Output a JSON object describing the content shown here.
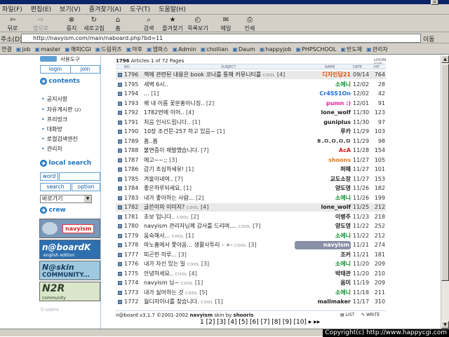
{
  "menu": [
    "파일(F)",
    "편집(E)",
    "보기(V)",
    "즐겨찾기(A)",
    "도구(T)",
    "도움말(H)"
  ],
  "toolbar": {
    "back": "뒤로",
    "forward": "앞으로",
    "stop": "중지",
    "refresh": "새로고침",
    "home": "홈",
    "search": "검색",
    "favorites": "즐겨찾기",
    "history": "목록보기",
    "mail": "메일",
    "print": "인쇄"
  },
  "address": {
    "label": "주소(D)",
    "url": "http://navyism.com/main/naboard.php?bd=11",
    "go": "이동"
  },
  "links": {
    "label": "연결",
    "items": [
      "job",
      "master",
      "해피CGI",
      "드림위즈",
      "야후",
      "엠파스",
      "Admin",
      "chollian",
      "Daum",
      "happyjob",
      "PHPSCHOOL",
      "반도체",
      "관리자"
    ]
  },
  "sidebar": {
    "top_text": "사용도구",
    "login": "login",
    "join": "join",
    "contents_title": "contents",
    "contents": [
      "공지사항",
      "자유게시판",
      "프리빙크",
      "대화방",
      "로컬검색엔진",
      "관리자"
    ],
    "contents_count": "(2)",
    "local_search_title": "local search",
    "word_label": "word",
    "search_btn": "search",
    "option_btn": "option",
    "select_value": "바로가기",
    "crew_title": "crew",
    "banners": [
      {
        "text": "navyism",
        "bg": "#7a98b8",
        "fg": "#ffffff"
      },
      {
        "text": "n@boardK",
        "sub": "english edition",
        "bg": "#2e6fb0",
        "fg": "#ffffff"
      },
      {
        "text": "N@skin",
        "sub": "COMMUNITY...",
        "bg": "#9ec9de",
        "fg": "#1a3a60"
      },
      {
        "text": "N2R",
        "sub": "community",
        "bg": "#d9e6c9",
        "fg": "#304030"
      }
    ],
    "users": "0 users"
  },
  "board": {
    "count": "1796",
    "count_text": "Articles 1 of 72 Pages",
    "login_link": "LOGIN",
    "join_link": "JOIN",
    "cols": {
      "no": "NO",
      "subject": "SUBJECT",
      "name": "NAME",
      "date": "DATE",
      "hit": "HIT"
    },
    "rows": [
      {
        "no": "1796",
        "subject": "책에 관련된 내용은 book 코너를 통해 커뮤니티를",
        "cnt": "[4]",
        "cool": "COOL",
        "name": "디자인답21",
        "name_color": "#e05010",
        "date": "09/14",
        "hit": "764",
        "hl": true
      },
      {
        "no": "1795",
        "subject": "새벽 6시..",
        "cnt": "",
        "cool": "",
        "name": "소에니",
        "name_color": "#0a8a2a",
        "date": "12/02",
        "hit": "28",
        "hl": false
      },
      {
        "no": "1794",
        "subject": "...",
        "cnt": "[1]",
        "cool": "",
        "name": "Cr4SS1On",
        "name_color": "#1d6dd8",
        "date": "12/02",
        "hit": "42",
        "hl": false
      },
      {
        "no": "1793",
        "subject": "왜 내 이름 꽃분홍아니징..",
        "cnt": "[2]",
        "cool": "",
        "name": "pumn :)",
        "name_color": "#e0209a",
        "date": "12/01",
        "hit": "91",
        "hl": false
      },
      {
        "no": "1792",
        "subject": "1782번에 이어..",
        "cnt": "[4]",
        "cool": "",
        "name": "lone_wolf",
        "name_color": "#222222",
        "date": "11/30",
        "hit": "123",
        "hl": false
      },
      {
        "no": "1791",
        "subject": "처음 인사드립니다..",
        "cnt": "[1]",
        "cool": "",
        "name": "guniplus",
        "name_color": "#222222",
        "date": "11/30",
        "hit": "97",
        "hl": false
      },
      {
        "no": "1790",
        "subject": "10장 조건문-257 하고 있음~",
        "cnt": "[1]",
        "cool": "",
        "name": "루카",
        "name_color": "#222222",
        "date": "11/29",
        "hit": "103",
        "hl": false
      },
      {
        "no": "1789",
        "subject": "흠..흠",
        "cnt": "",
        "cool": "",
        "name": "ㅎ.ㅁ.ㅁ.ㅁ.ㅁ",
        "name_color": "#222222",
        "date": "11/29",
        "hit": "98",
        "hl": false
      },
      {
        "no": "1788",
        "subject": "불면증이 재발했습니다.",
        "cnt": "[7]",
        "cool": "",
        "name": "AcA",
        "name_color": "#d02020",
        "date": "11/28",
        "hit": "154",
        "hl": false
      },
      {
        "no": "1787",
        "subject": "에고~~;;",
        "cnt": "[3]",
        "cool": "",
        "name": "shoons",
        "name_color": "#e07818",
        "date": "11/27",
        "hit": "105",
        "hl": false
      },
      {
        "no": "1786",
        "subject": "갑기 조심하세유!",
        "cnt": "[1]",
        "cool": "",
        "name": "퍼떼",
        "name_color": "#222222",
        "date": "11/27",
        "hit": "101",
        "hl": false
      },
      {
        "no": "1785",
        "subject": "겨울이네여..",
        "cnt": "[7]",
        "cool": "",
        "name": "교도소장",
        "name_color": "#222222",
        "date": "11/27",
        "hit": "153",
        "hl": false
      },
      {
        "no": "1784",
        "subject": "좋은하루되세요,",
        "cnt": "[1]",
        "cool": "",
        "name": "양도영",
        "name_color": "#222222",
        "date": "11/26",
        "hit": "182",
        "hl": false
      },
      {
        "no": "1783",
        "subject": "내가 좋아하는 사람...",
        "cnt": "[2]",
        "cool": "",
        "name": "소에니",
        "name_color": "#0a8a2a",
        "date": "11/26",
        "hit": "199",
        "hl": false
      },
      {
        "no": "1782",
        "subject": "글쓴이의 이미지?",
        "cnt": "[4]",
        "cool": "COOL",
        "name": "lone_wolf",
        "name_color": "#222222",
        "date": "11/25",
        "hit": "212",
        "hl": true
      },
      {
        "no": "1781",
        "subject": "초보 입니다..",
        "cnt": "[2]",
        "cool": "COOL",
        "name": "이병주",
        "name_color": "#222222",
        "date": "11/23",
        "hit": "218",
        "hl": false
      },
      {
        "no": "1780",
        "subject": "navyism 관리자님께 감사를 드리며....",
        "cnt": "[7]",
        "cool": "COOL",
        "name": "양도영",
        "name_color": "#222222",
        "date": "11/22",
        "hit": "252",
        "hl": false
      },
      {
        "no": "1779",
        "subject": "움숙해서...",
        "cnt": "[1]",
        "cool": "COOL",
        "name": "소에니",
        "name_color": "#0a8a2a",
        "date": "11/22",
        "hit": "212",
        "hl": false
      },
      {
        "no": "1778",
        "subject": "마노홈에서 쫓아옴... 생활사투리 - ㅅ-",
        "cnt": "[3]",
        "cool": "COOL",
        "name": "navyism",
        "name_color": "#ffffff",
        "date": "11/21",
        "hit": "274",
        "hl": false
      },
      {
        "no": "1777",
        "subject": "피곤한 하루...",
        "cnt": "[3]",
        "cool": "",
        "name": "조커",
        "name_color": "#222222",
        "date": "11/21",
        "hit": "181",
        "hl": false
      },
      {
        "no": "1776",
        "subject": "내가 자신 있는 일",
        "cnt": "[3]",
        "cool": "COOL",
        "name": "소에니",
        "name_color": "#0a8a2a",
        "date": "11/20",
        "hit": "209",
        "hl": false
      },
      {
        "no": "1775",
        "subject": "안녕하세요..",
        "cnt": "[4]",
        "cool": "COOL",
        "name": "박태관",
        "name_color": "#222222",
        "date": "11/20",
        "hit": "210",
        "hl": false
      },
      {
        "no": "1774",
        "subject": "navyism 님~",
        "cnt": "[1]",
        "cool": "COOL",
        "name": "옴미",
        "name_color": "#222222",
        "date": "11/19",
        "hit": "209",
        "hl": false
      },
      {
        "no": "1773",
        "subject": "내가 싫어하는 것",
        "cnt": "[5]",
        "cool": "COOL",
        "name": "소에니",
        "name_color": "#0a8a2a",
        "date": "11/18",
        "hit": "211",
        "hl": false
      },
      {
        "no": "1772",
        "subject": "월디자이너를 찾습니다.",
        "cnt": "[1]",
        "cool": "COOL",
        "name": "mallmaker",
        "name_color": "#222222",
        "date": "11/17",
        "hit": "310",
        "hl": false
      }
    ],
    "footer_left": "n@board v3.1.7 ©2001-2002",
    "footer_brand": "navyism",
    "footer_skin": "skin by",
    "footer_skin_author": "shooris",
    "footer_list": "LIST",
    "footer_write": "WRITE",
    "pager": "1 [2] [3] [4] [5] [6] [7] [8] [9] [10] ▸ ▸▸"
  },
  "status": {
    "copyright": "Copyright(c) http://www.happycgi.com"
  }
}
